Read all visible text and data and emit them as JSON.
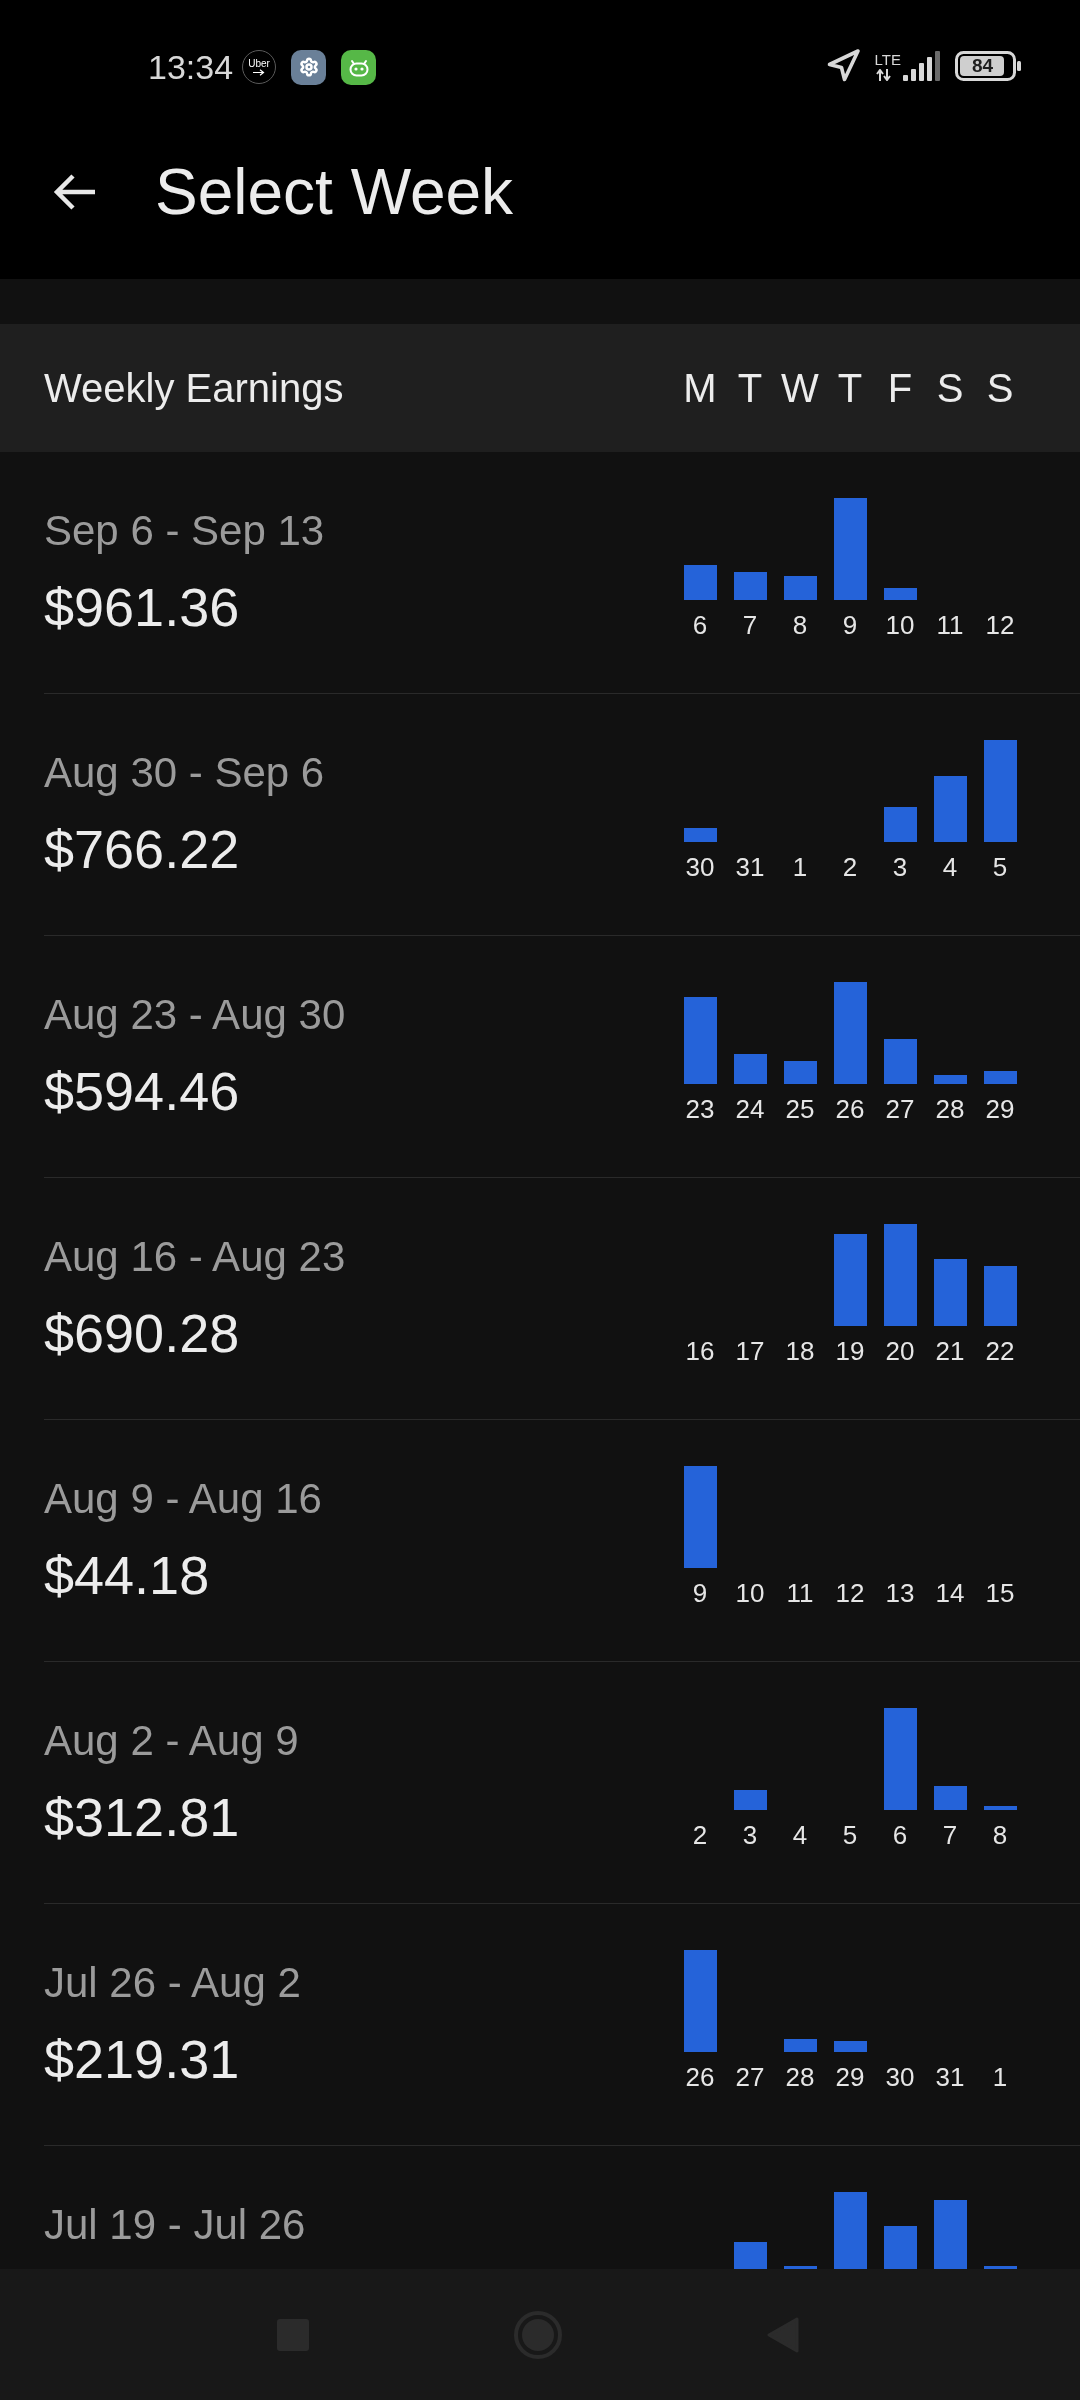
{
  "status_bar": {
    "time": "13:34",
    "notifications": [
      {
        "kind": "app",
        "label": "Uber"
      },
      {
        "kind": "settings"
      },
      {
        "kind": "robot"
      }
    ],
    "network": "LTE",
    "battery": "84"
  },
  "header": {
    "title": "Select Week"
  },
  "column_header": {
    "label": "Weekly Earnings",
    "days": [
      "M",
      "T",
      "W",
      "T",
      "F",
      "S",
      "S"
    ]
  },
  "weeks": [
    {
      "range": "Sep 6 - Sep 13",
      "amount": "$961.36",
      "days": [
        "6",
        "7",
        "8",
        "9",
        "10",
        "11",
        "12"
      ]
    },
    {
      "range": "Aug 30 - Sep 6",
      "amount": "$766.22",
      "days": [
        "30",
        "31",
        "1",
        "2",
        "3",
        "4",
        "5"
      ]
    },
    {
      "range": "Aug 23 - Aug 30",
      "amount": "$594.46",
      "days": [
        "23",
        "24",
        "25",
        "26",
        "27",
        "28",
        "29"
      ]
    },
    {
      "range": "Aug 16 - Aug 23",
      "amount": "$690.28",
      "days": [
        "16",
        "17",
        "18",
        "19",
        "20",
        "21",
        "22"
      ]
    },
    {
      "range": "Aug 9 - Aug 16",
      "amount": "$44.18",
      "days": [
        "9",
        "10",
        "11",
        "12",
        "13",
        "14",
        "15"
      ]
    },
    {
      "range": "Aug 2 - Aug 9",
      "amount": "$312.81",
      "days": [
        "2",
        "3",
        "4",
        "5",
        "6",
        "7",
        "8"
      ]
    },
    {
      "range": "Jul 26 - Aug 2",
      "amount": "$219.31",
      "days": [
        "26",
        "27",
        "28",
        "29",
        "30",
        "31",
        "1"
      ]
    },
    {
      "range": "Jul 19 - Jul 26"
    }
  ]
}
